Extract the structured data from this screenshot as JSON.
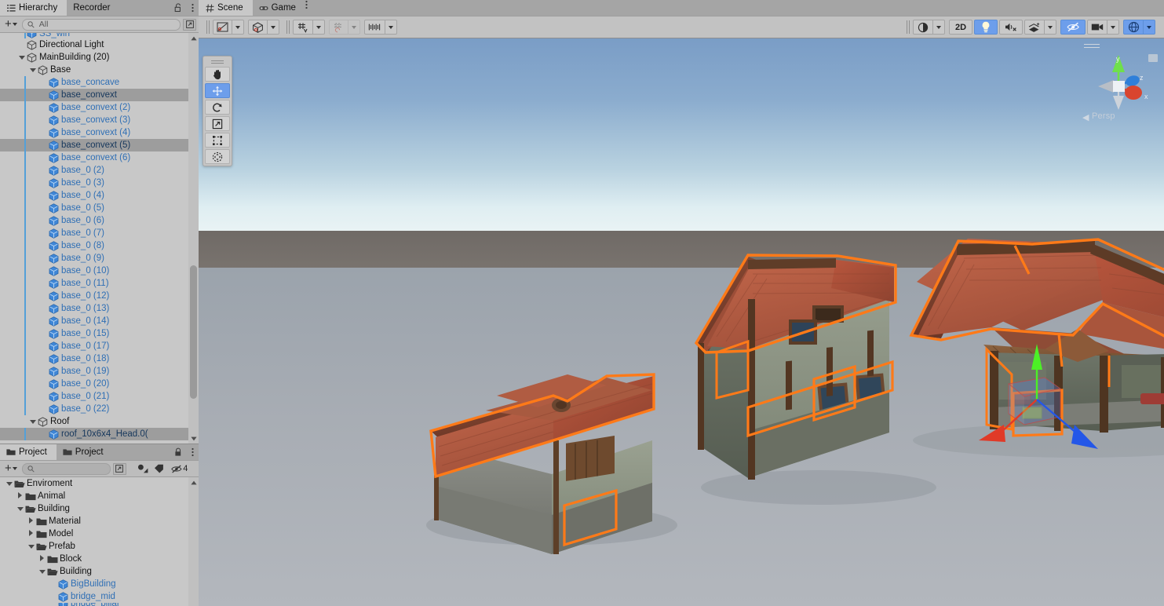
{
  "hierarchy_panel": {
    "tabs": [
      {
        "label": "Hierarchy",
        "icon": "hierarchy-icon",
        "active": true
      },
      {
        "label": "Recorder",
        "icon": "recorder-icon",
        "active": false
      }
    ],
    "lock_icon": "unlocked-padlock-icon",
    "menu_icon": "kebab-menu-icon",
    "create_label": "+",
    "search": {
      "placeholder": "All",
      "value": "",
      "icon": "search-icon"
    },
    "sort_icon": "sort-window-icon",
    "rows": [
      {
        "label": "SS_win",
        "indent": 2,
        "icon": "prefab-cube-icon",
        "type": "prefab",
        "partial": true,
        "chevron": true,
        "prefabline": true
      },
      {
        "label": "Directional Light",
        "indent": 2,
        "icon": "gameobject-icon",
        "type": "gameobject",
        "chevron": false,
        "prefabline": false
      },
      {
        "label": "MainBuilding (20)",
        "indent": 2,
        "icon": "gameobject-icon",
        "type": "gameobject",
        "twisty": "down",
        "chevron": false,
        "prefabline": false
      },
      {
        "label": "Base",
        "indent": 3,
        "icon": "gameobject-icon",
        "type": "gameobject",
        "twisty": "down",
        "chevron": false,
        "prefabline": false
      },
      {
        "label": "base_concave",
        "indent": 4,
        "icon": "prefab-cube-icon",
        "type": "prefab",
        "chevron": true,
        "prefabline": true
      },
      {
        "label": "base_convext",
        "indent": 4,
        "icon": "prefab-cube-icon",
        "type": "prefab",
        "chevron": true,
        "prefabline": true,
        "selected": true
      },
      {
        "label": "base_convext (2)",
        "indent": 4,
        "icon": "prefab-cube-icon",
        "type": "prefab",
        "chevron": true,
        "prefabline": true
      },
      {
        "label": "base_convext (3)",
        "indent": 4,
        "icon": "prefab-cube-icon",
        "type": "prefab",
        "chevron": true,
        "prefabline": true
      },
      {
        "label": "base_convext (4)",
        "indent": 4,
        "icon": "prefab-cube-icon",
        "type": "prefab",
        "chevron": true,
        "prefabline": true
      },
      {
        "label": "base_convext (5)",
        "indent": 4,
        "icon": "prefab-cube-icon",
        "type": "prefab",
        "chevron": true,
        "prefabline": true,
        "selected": true
      },
      {
        "label": "base_convext (6)",
        "indent": 4,
        "icon": "prefab-cube-icon",
        "type": "prefab",
        "chevron": true,
        "prefabline": true
      },
      {
        "label": "base_0 (2)",
        "indent": 4,
        "icon": "prefab-cube-icon",
        "type": "prefab",
        "chevron": true,
        "prefabline": true
      },
      {
        "label": "base_0 (3)",
        "indent": 4,
        "icon": "prefab-cube-icon",
        "type": "prefab",
        "chevron": true,
        "prefabline": true
      },
      {
        "label": "base_0 (4)",
        "indent": 4,
        "icon": "prefab-cube-icon",
        "type": "prefab",
        "chevron": true,
        "prefabline": true
      },
      {
        "label": "base_0 (5)",
        "indent": 4,
        "icon": "prefab-cube-icon",
        "type": "prefab",
        "chevron": true,
        "prefabline": true
      },
      {
        "label": "base_0 (6)",
        "indent": 4,
        "icon": "prefab-cube-icon",
        "type": "prefab",
        "chevron": true,
        "prefabline": true
      },
      {
        "label": "base_0 (7)",
        "indent": 4,
        "icon": "prefab-cube-icon",
        "type": "prefab",
        "chevron": true,
        "prefabline": true
      },
      {
        "label": "base_0 (8)",
        "indent": 4,
        "icon": "prefab-cube-icon",
        "type": "prefab",
        "chevron": true,
        "prefabline": true
      },
      {
        "label": "base_0 (9)",
        "indent": 4,
        "icon": "prefab-cube-icon",
        "type": "prefab",
        "chevron": true,
        "prefabline": true
      },
      {
        "label": "base_0 (10)",
        "indent": 4,
        "icon": "prefab-cube-icon",
        "type": "prefab",
        "chevron": true,
        "prefabline": true
      },
      {
        "label": "base_0 (11)",
        "indent": 4,
        "icon": "prefab-cube-icon",
        "type": "prefab",
        "chevron": true,
        "prefabline": true
      },
      {
        "label": "base_0 (12)",
        "indent": 4,
        "icon": "prefab-cube-icon",
        "type": "prefab",
        "chevron": true,
        "prefabline": true
      },
      {
        "label": "base_0 (13)",
        "indent": 4,
        "icon": "prefab-cube-icon",
        "type": "prefab",
        "chevron": true,
        "prefabline": true
      },
      {
        "label": "base_0 (14)",
        "indent": 4,
        "icon": "prefab-cube-icon",
        "type": "prefab",
        "chevron": true,
        "prefabline": true
      },
      {
        "label": "base_0 (15)",
        "indent": 4,
        "icon": "prefab-cube-icon",
        "type": "prefab",
        "chevron": true,
        "prefabline": true
      },
      {
        "label": "base_0 (17)",
        "indent": 4,
        "icon": "prefab-cube-icon",
        "type": "prefab",
        "chevron": true,
        "prefabline": true
      },
      {
        "label": "base_0 (18)",
        "indent": 4,
        "icon": "prefab-cube-icon",
        "type": "prefab",
        "chevron": true,
        "prefabline": true
      },
      {
        "label": "base_0 (19)",
        "indent": 4,
        "icon": "prefab-cube-icon",
        "type": "prefab",
        "chevron": true,
        "prefabline": true
      },
      {
        "label": "base_0 (20)",
        "indent": 4,
        "icon": "prefab-cube-icon",
        "type": "prefab",
        "chevron": true,
        "prefabline": true
      },
      {
        "label": "base_0 (21)",
        "indent": 4,
        "icon": "prefab-cube-icon",
        "type": "prefab",
        "chevron": true,
        "prefabline": true
      },
      {
        "label": "base_0 (22)",
        "indent": 4,
        "icon": "prefab-cube-icon",
        "type": "prefab",
        "chevron": true,
        "prefabline": true
      },
      {
        "label": "Roof",
        "indent": 3,
        "icon": "gameobject-icon",
        "type": "gameobject",
        "twisty": "down",
        "chevron": false,
        "prefabline": false
      },
      {
        "label": "roof_10x6x4_Head.0(",
        "indent": 4,
        "icon": "prefab-cube-icon",
        "type": "prefab",
        "chevron": true,
        "prefabline": true,
        "selected": true
      }
    ]
  },
  "project_panel": {
    "tabs": [
      {
        "label": "Project",
        "icon": "project-folder-icon",
        "active": true
      },
      {
        "label": "Project",
        "icon": "project-folder-icon",
        "active": false
      }
    ],
    "lock_icon": "locked-padlock-icon",
    "menu_icon": "kebab-menu-icon",
    "create_label": "+",
    "search": {
      "placeholder": "",
      "value": "",
      "icon": "search-icon"
    },
    "sort_icon": "sort-window-icon",
    "filter_buttons": [
      {
        "icon": "filter-by-type-icon"
      },
      {
        "icon": "filter-by-label-icon"
      }
    ],
    "hidden_count": "4",
    "hidden_icon": "eye-slash-icon",
    "rows": [
      {
        "label": "Enviroment",
        "indent": 1,
        "icon": "folder-open-icon",
        "twisty": "down"
      },
      {
        "label": "Animal",
        "indent": 2,
        "icon": "folder-icon",
        "twisty": "right"
      },
      {
        "label": "Building",
        "indent": 2,
        "icon": "folder-open-icon",
        "twisty": "down"
      },
      {
        "label": "Material",
        "indent": 3,
        "icon": "folder-icon",
        "twisty": "right"
      },
      {
        "label": "Model",
        "indent": 3,
        "icon": "folder-icon",
        "twisty": "right"
      },
      {
        "label": "Prefab",
        "indent": 3,
        "icon": "folder-open-icon",
        "twisty": "down"
      },
      {
        "label": "Block",
        "indent": 4,
        "icon": "folder-icon",
        "twisty": "right"
      },
      {
        "label": "Building",
        "indent": 4,
        "icon": "folder-open-icon",
        "twisty": "down"
      },
      {
        "label": "BigBuilding",
        "indent": 5,
        "icon": "prefab-cube-icon",
        "type": "prefab"
      },
      {
        "label": "bridge_mid",
        "indent": 5,
        "icon": "prefab-cube-icon",
        "type": "prefab"
      },
      {
        "label": "bridge_pillar",
        "indent": 5,
        "icon": "prefab-cube-icon",
        "type": "prefab",
        "partial": true
      }
    ]
  },
  "scene_panel": {
    "tabs": [
      {
        "label": "Scene",
        "icon": "scene-grid-icon",
        "active": true
      },
      {
        "label": "Game",
        "icon": "game-controller-icon",
        "active": false
      }
    ],
    "menu_icon": "kebab-menu-icon",
    "toolbar_left": [
      {
        "name": "draw-mode-dropdown",
        "icon": "shaded-mode-icon",
        "has_arrow": true,
        "active": false
      },
      {
        "name": "render-mode-dropdown",
        "icon": "render-cube-icon",
        "has_arrow": true,
        "active": false
      },
      {
        "name": "grid-visibility",
        "icon": "grid-axis-icon",
        "has_arrow": true,
        "active": false
      },
      {
        "name": "grid-snapping",
        "icon": "grid-snap-icon",
        "has_arrow": true,
        "active": false,
        "disabled": true
      },
      {
        "name": "increment-snap",
        "icon": "ruler-snap-icon",
        "has_arrow": true,
        "active": false
      }
    ],
    "toolbar_right": [
      {
        "name": "scene-shading-dropdown",
        "icon": "half-circle-icon",
        "label": "",
        "has_arrow": true,
        "active": false
      },
      {
        "name": "toggle-2d",
        "icon": "",
        "label": "2D",
        "has_arrow": false,
        "active": false
      },
      {
        "name": "toggle-lighting",
        "icon": "lightbulb-icon",
        "label": "",
        "has_arrow": false,
        "active": true
      },
      {
        "name": "toggle-audio",
        "icon": "audio-mute-icon",
        "label": "",
        "has_arrow": false,
        "active": false
      },
      {
        "name": "toggle-effects",
        "icon": "fx-layers-icon",
        "label": "",
        "has_arrow": true,
        "active": false
      },
      {
        "name": "toggle-scene-visibility",
        "icon": "eye-slash-icon",
        "label": "",
        "has_arrow": false,
        "active": true
      },
      {
        "name": "scene-camera-settings",
        "icon": "camera-icon",
        "label": "",
        "has_arrow": true,
        "active": false
      },
      {
        "name": "gizmos-toggle",
        "icon": "gizmos-globe-icon",
        "label": "",
        "has_arrow": true,
        "active": true
      }
    ],
    "tools": [
      {
        "name": "hand-tool",
        "icon": "hand-icon",
        "active": false
      },
      {
        "name": "move-tool",
        "icon": "move-arrows-icon",
        "active": true
      },
      {
        "name": "rotate-tool",
        "icon": "rotate-icon",
        "active": false
      },
      {
        "name": "scale-tool",
        "icon": "scale-icon",
        "active": false
      },
      {
        "name": "rect-tool",
        "icon": "rect-transform-icon",
        "active": false
      },
      {
        "name": "transform-tool",
        "icon": "transform-combined-icon",
        "active": false
      }
    ],
    "view_gizmo": {
      "projection_label": "Persp",
      "axis_labels": {
        "x": "x",
        "y": "y",
        "z": "z"
      },
      "axis_colors": {
        "x": "#d9452f",
        "y": "#6fe04a",
        "z": "#2f7fd9"
      }
    },
    "selection_outline_color": "#ff7a18",
    "move_gizmo": {
      "x_color": "#e03a28",
      "y_color": "#4cf026",
      "z_color": "#2457e8"
    },
    "scene_content": {
      "buildings": [
        "small-house",
        "medium-house",
        "large-building-complex"
      ],
      "sky_top_color": "#7a9dc6",
      "sky_horizon_color": "#e9f3f4",
      "ground_far_color": "#746f6a",
      "ground_near_color": "#a6abb2"
    }
  }
}
